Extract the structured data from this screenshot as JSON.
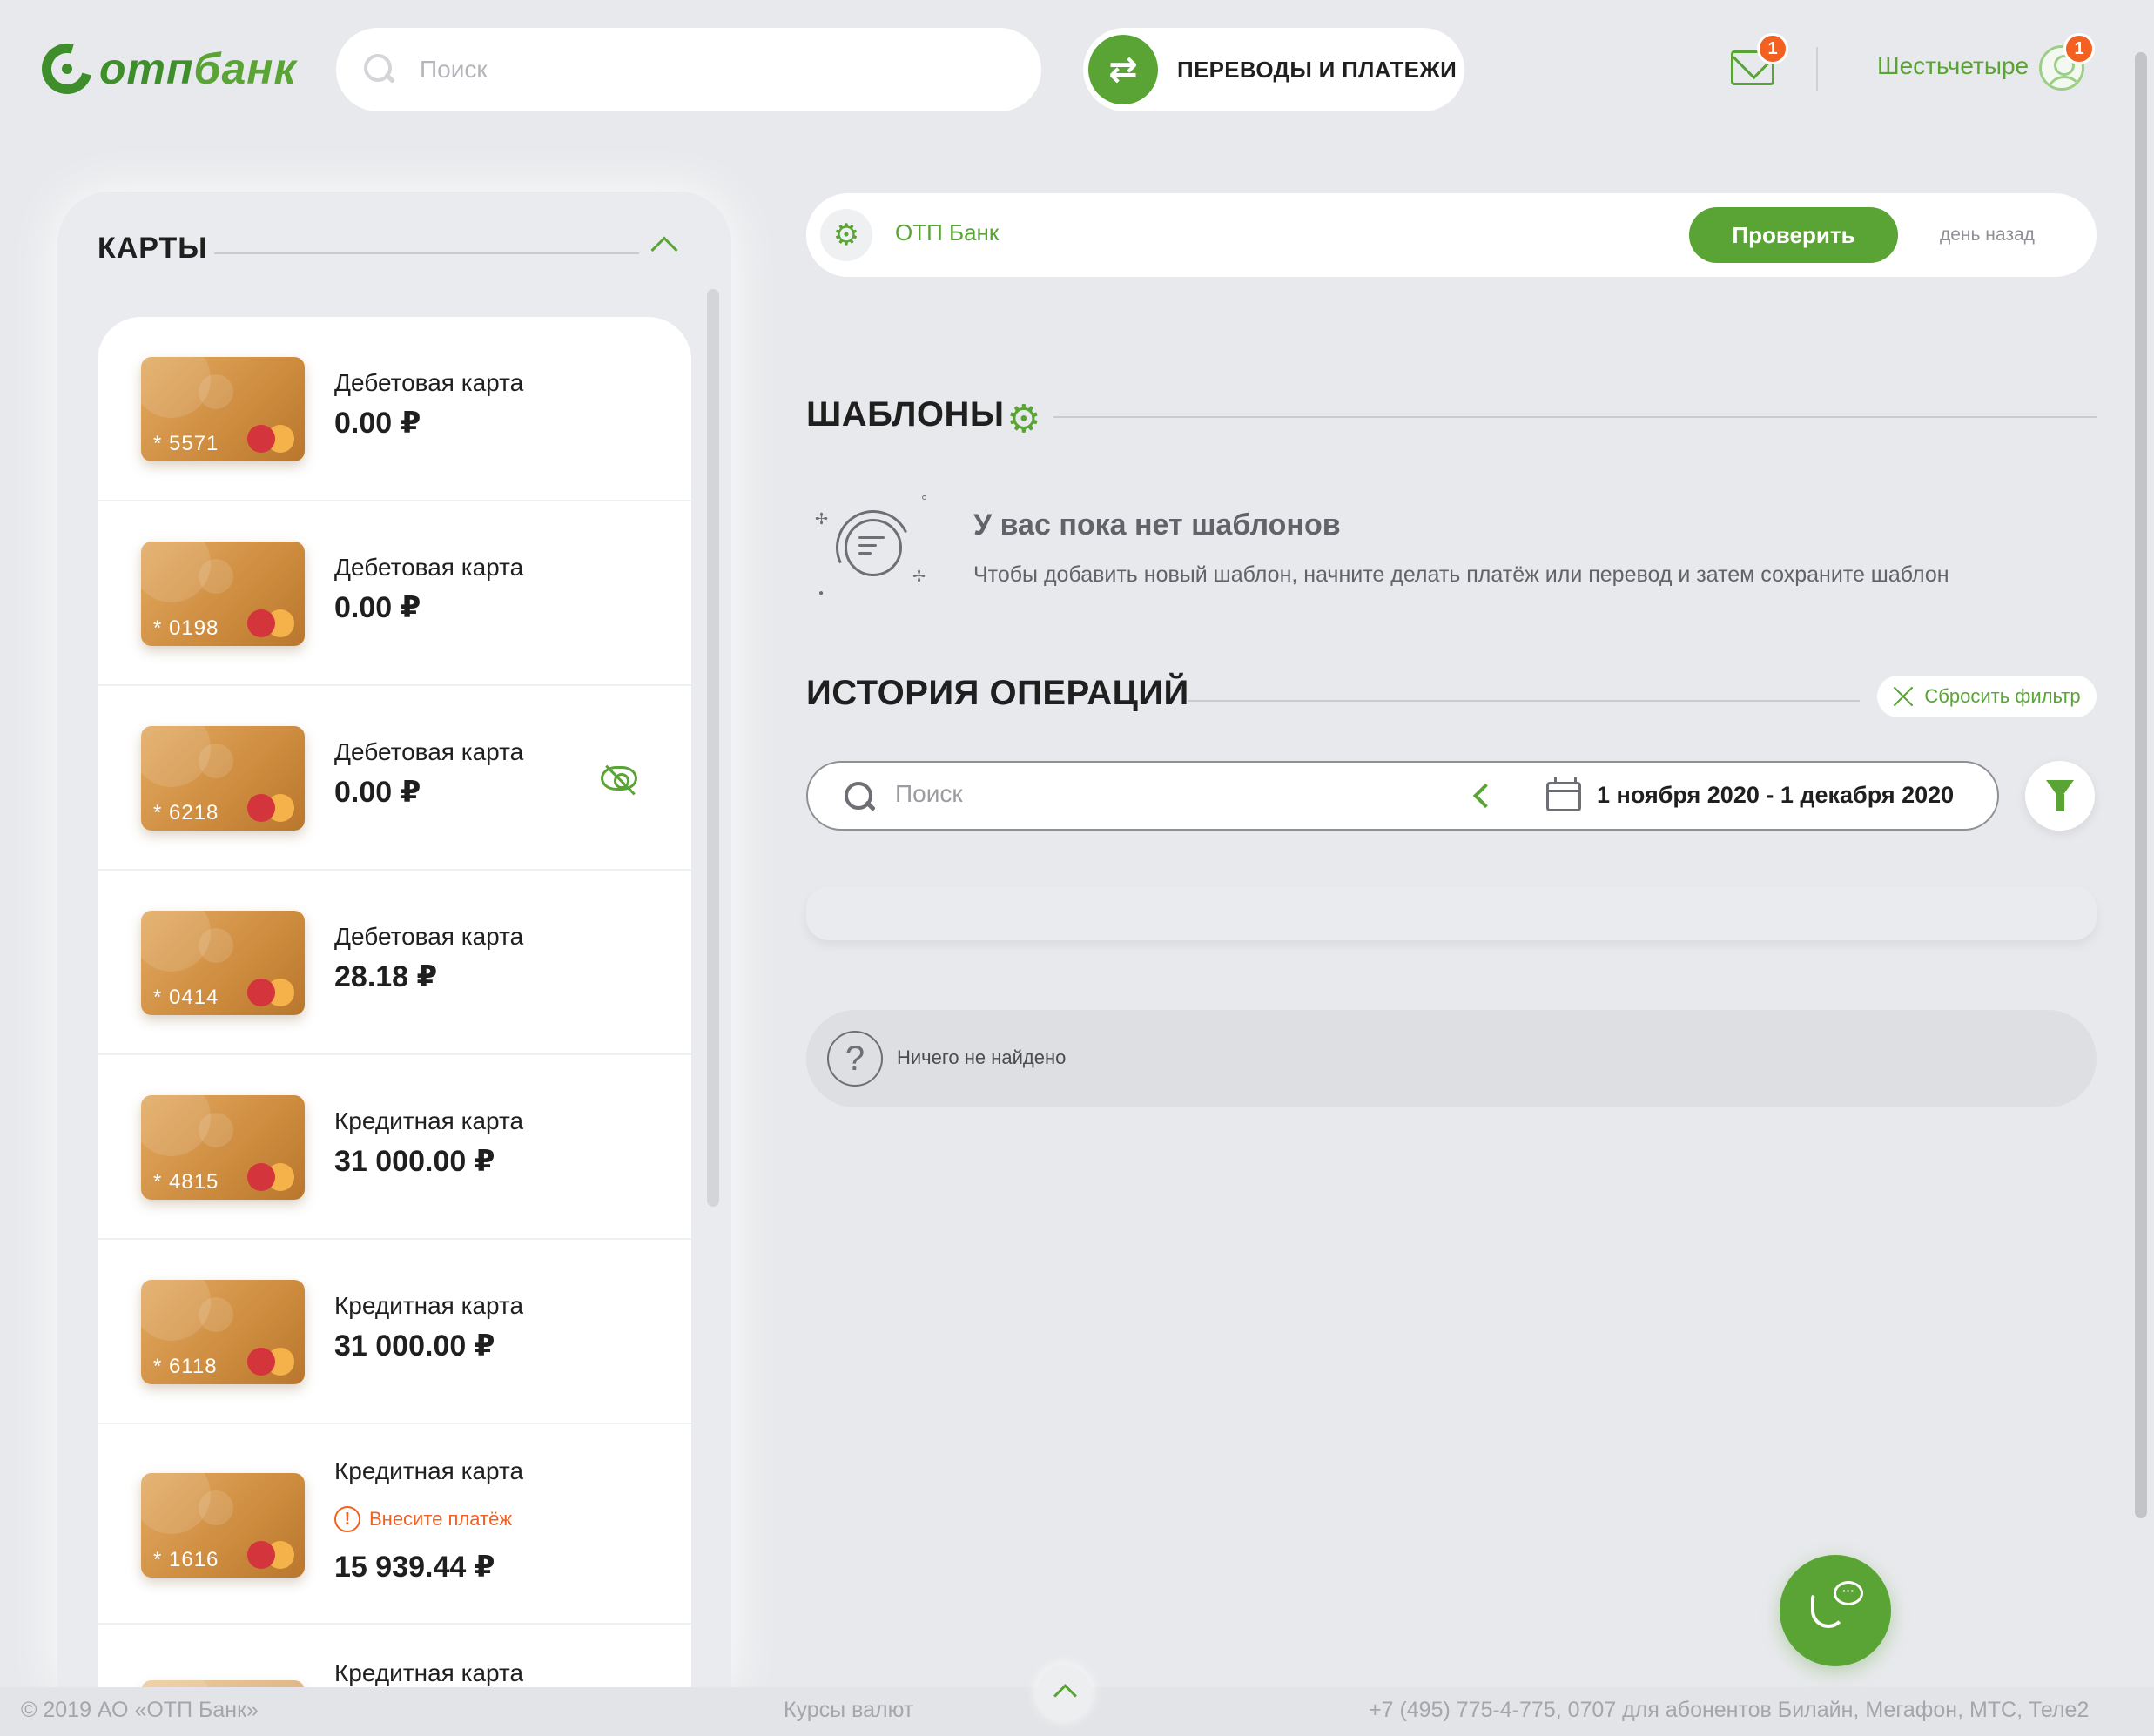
{
  "header": {
    "logo_prefix": "отп",
    "logo_suffix": "банк",
    "search_placeholder": "Поиск",
    "transfers_label": "ПЕРЕВОДЫ И ПЛАТЕЖИ",
    "mail_badge": "1",
    "username": "Шестьчетыре",
    "profile_badge": "1"
  },
  "cards": {
    "title": "КАРТЫ",
    "items": [
      {
        "type": "Дебетовая карта",
        "amount": "0.00 ₽",
        "number": "* 5571"
      },
      {
        "type": "Дебетовая карта",
        "amount": "0.00 ₽",
        "number": "* 0198"
      },
      {
        "type": "Дебетовая карта",
        "amount": "0.00 ₽",
        "number": "* 6218",
        "hidden": true
      },
      {
        "type": "Дебетовая карта",
        "amount": "28.18 ₽",
        "number": "* 0414"
      },
      {
        "type": "Кредитная карта",
        "amount": "31 000.00 ₽",
        "number": "* 4815"
      },
      {
        "type": "Кредитная карта",
        "amount": "31 000.00 ₽",
        "number": "* 6118"
      },
      {
        "type": "Кредитная карта",
        "amount": "15 939.44 ₽",
        "number": "* 1616",
        "warning": "Внесите платёж"
      },
      {
        "type": "Кредитная карта"
      }
    ]
  },
  "notice": {
    "bank": "ОТП Банк",
    "button": "Проверить",
    "time": "день назад"
  },
  "templates": {
    "title": "ШАБЛОНЫ",
    "empty_title": "У вас пока нет шаблонов",
    "empty_desc": "Чтобы добавить новый шаблон, начните делать платёж или перевод и затем сохраните шаблон"
  },
  "history": {
    "title": "ИСТОРИЯ ОПЕРАЦИЙ",
    "reset_filter": "Сбросить фильтр",
    "search_placeholder": "Поиск",
    "date_range": "1 ноября 2020 - 1 декабря 2020",
    "nothing_found": "Ничего не найдено"
  },
  "footer": {
    "copyright": "© 2019 АО «ОТП Банк»",
    "rates": "Курсы валют",
    "phones": "+7 (495) 775-4-775,  0707 для абонентов Билайн, Мегафон, МТС, Теле2"
  },
  "colors": {
    "brand_green": "#5aa436",
    "dark_green": "#3e8f2c",
    "badge_orange": "#f26122",
    "card_gold": "#d99a4f",
    "background": "#e8e9ec"
  },
  "icons": [
    "search-icon",
    "transfer-arrows-icon",
    "mail-icon",
    "user-avatar-icon",
    "chevron-up-icon",
    "eye-off-icon",
    "gear-icon",
    "templates-empty-icon",
    "close-icon",
    "chevron-left-icon",
    "calendar-icon",
    "filter-icon",
    "question-icon",
    "phone-chat-icon",
    "warning-icon",
    "mastercard-logo"
  ]
}
